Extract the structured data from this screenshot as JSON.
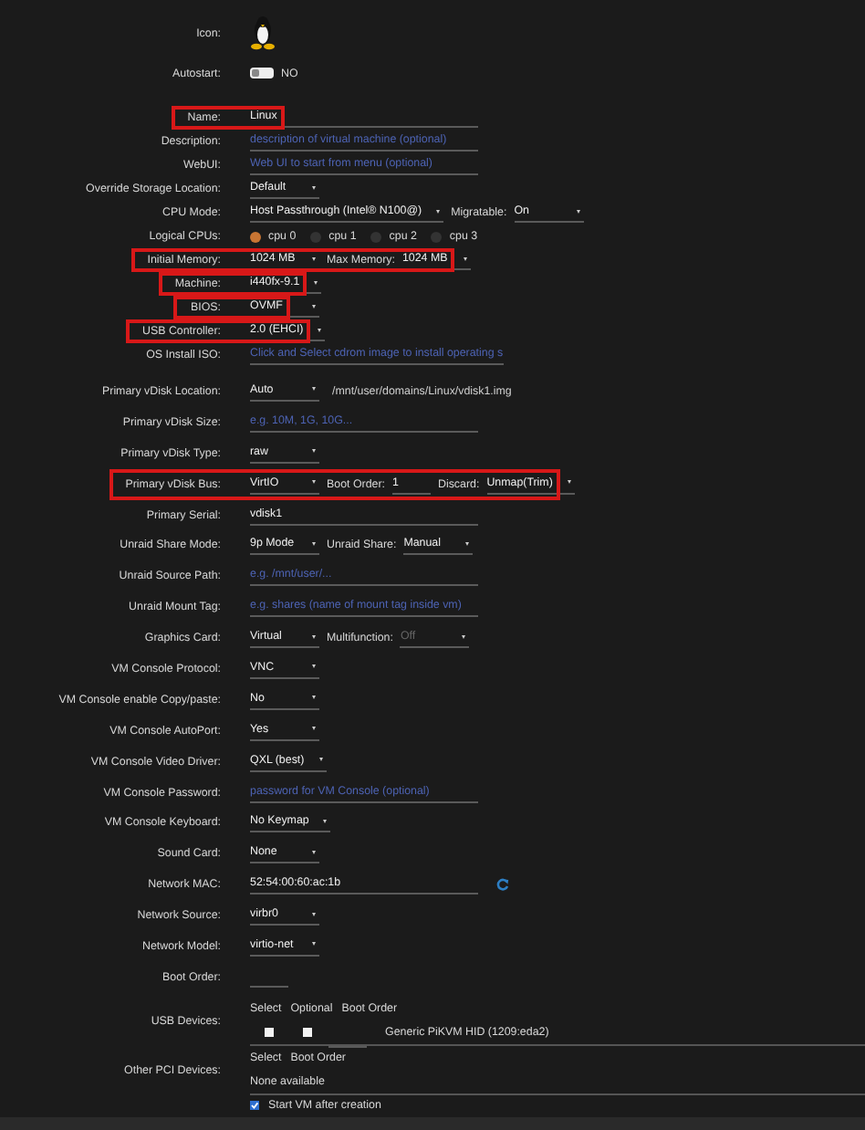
{
  "sections": [
    {
      "rows": [
        {
          "label": "Icon:",
          "highlighted": false,
          "fields": [
            {
              "kind": "icon"
            }
          ]
        },
        {
          "label": "Autostart:",
          "highlighted": false,
          "fields": [
            {
              "kind": "toggle",
              "on": false,
              "text": "NO"
            }
          ]
        }
      ]
    },
    {
      "rows": [
        {
          "label": "Name:",
          "highlighted": true,
          "fields": [
            {
              "kind": "text",
              "value": "Linux"
            }
          ]
        },
        {
          "label": "Description:",
          "highlighted": false,
          "fields": [
            {
              "kind": "placeholder",
              "placeholder": "description of virtual machine (optional)"
            }
          ]
        },
        {
          "label": "WebUI:",
          "highlighted": false,
          "fields": [
            {
              "kind": "placeholder",
              "placeholder": "Web UI to start from menu (optional)"
            }
          ]
        },
        {
          "label": "Override Storage Location:",
          "highlighted": false,
          "fields": [
            {
              "kind": "select",
              "value": "Default"
            }
          ]
        },
        {
          "label": "CPU Mode:",
          "highlighted": false,
          "fields": [
            {
              "kind": "select",
              "value": "Host Passthrough (Intel® N100@)"
            },
            {
              "kind": "caption",
              "text": "Migratable:"
            },
            {
              "kind": "select",
              "value": "On"
            }
          ]
        },
        {
          "label": "Logical CPUs:",
          "highlighted": false,
          "fields": [
            {
              "kind": "cpus",
              "items": [
                {
                  "label": "cpu 0",
                  "selected": true
                },
                {
                  "label": "cpu 1",
                  "selected": false
                },
                {
                  "label": "cpu 2",
                  "selected": false
                },
                {
                  "label": "cpu 3",
                  "selected": false
                }
              ]
            }
          ]
        },
        {
          "label": "Initial Memory:",
          "highlighted": true,
          "fields": [
            {
              "kind": "select",
              "value": "1024 MB"
            },
            {
              "kind": "caption",
              "text": "Max Memory:"
            },
            {
              "kind": "select",
              "value": "1024 MB"
            }
          ]
        },
        {
          "label": "Machine:",
          "highlighted": true,
          "fields": [
            {
              "kind": "select",
              "value": "i440fx-9.1"
            }
          ]
        },
        {
          "label": "BIOS:",
          "highlighted": true,
          "fields": [
            {
              "kind": "select",
              "value": "OVMF"
            }
          ]
        },
        {
          "label": "USB Controller:",
          "highlighted": true,
          "fields": [
            {
              "kind": "select",
              "value": "2.0 (EHCI)"
            }
          ]
        },
        {
          "label": "OS Install ISO:",
          "highlighted": false,
          "fields": [
            {
              "kind": "placeholder",
              "placeholder": "Click and Select cdrom image to install operating s"
            }
          ]
        }
      ]
    },
    {
      "rows": [
        {
          "label": "Primary vDisk Location:",
          "highlighted": false,
          "fields": [
            {
              "kind": "select",
              "value": "Auto"
            },
            {
              "kind": "path",
              "text": "/mnt/user/domains/Linux/vdisk1.img"
            }
          ]
        },
        {
          "label": "Primary vDisk Size:",
          "highlighted": false,
          "fields": [
            {
              "kind": "placeholder",
              "placeholder": "e.g. 10M, 1G, 10G..."
            }
          ]
        },
        {
          "label": "Primary vDisk Type:",
          "highlighted": false,
          "fields": [
            {
              "kind": "select",
              "value": "raw"
            }
          ]
        },
        {
          "label": "Primary vDisk Bus:",
          "highlighted": true,
          "fields": [
            {
              "kind": "select",
              "value": "VirtIO"
            },
            {
              "kind": "caption",
              "text": "Boot Order:"
            },
            {
              "kind": "number",
              "value": "1"
            },
            {
              "kind": "caption",
              "text": "Discard:"
            },
            {
              "kind": "select",
              "value": "Unmap(Trim)"
            }
          ]
        },
        {
          "label": "Primary Serial:",
          "highlighted": false,
          "fields": [
            {
              "kind": "text",
              "value": "vdisk1"
            }
          ]
        },
        {
          "label": "Unraid Share Mode:",
          "highlighted": false,
          "fields": [
            {
              "kind": "select",
              "value": "9p Mode"
            },
            {
              "kind": "caption",
              "text": "Unraid Share:"
            },
            {
              "kind": "select",
              "value": "Manual"
            }
          ]
        },
        {
          "label": "Unraid Source Path:",
          "highlighted": false,
          "fields": [
            {
              "kind": "placeholder",
              "placeholder": "e.g. /mnt/user/..."
            }
          ]
        },
        {
          "label": "Unraid Mount Tag:",
          "highlighted": false,
          "fields": [
            {
              "kind": "placeholder",
              "placeholder": "e.g. shares (name of mount tag inside vm)"
            }
          ]
        },
        {
          "label": "Graphics Card:",
          "highlighted": false,
          "fields": [
            {
              "kind": "select",
              "value": "Virtual"
            },
            {
              "kind": "caption",
              "text": "Multifunction:"
            },
            {
              "kind": "select",
              "value": "Off",
              "disabled": true
            }
          ]
        },
        {
          "label": "VM Console Protocol:",
          "highlighted": false,
          "fields": [
            {
              "kind": "select",
              "value": "VNC"
            }
          ]
        },
        {
          "label": "VM Console enable Copy/paste:",
          "highlighted": false,
          "fields": [
            {
              "kind": "select",
              "value": "No"
            }
          ]
        },
        {
          "label": "VM Console AutoPort:",
          "highlighted": false,
          "fields": [
            {
              "kind": "select",
              "value": "Yes"
            }
          ]
        },
        {
          "label": "VM Console Video Driver:",
          "highlighted": false,
          "fields": [
            {
              "kind": "select",
              "value": "QXL (best)"
            }
          ]
        },
        {
          "label": "VM Console Password:",
          "highlighted": false,
          "fields": [
            {
              "kind": "placeholder",
              "placeholder": "password for VM Console (optional)"
            }
          ]
        },
        {
          "label": "VM Console Keyboard:",
          "highlighted": false,
          "fields": [
            {
              "kind": "select",
              "value": "No Keymap"
            }
          ]
        },
        {
          "label": "Sound Card:",
          "highlighted": false,
          "fields": [
            {
              "kind": "select",
              "value": "None"
            }
          ]
        },
        {
          "label": "Network MAC:",
          "highlighted": false,
          "fields": [
            {
              "kind": "text",
              "value": "52:54:00:60:ac:1b"
            },
            {
              "kind": "refresh"
            }
          ]
        },
        {
          "label": "Network Source:",
          "highlighted": false,
          "fields": [
            {
              "kind": "select",
              "value": "virbr0"
            }
          ]
        },
        {
          "label": "Network Model:",
          "highlighted": false,
          "fields": [
            {
              "kind": "select",
              "value": "virtio-net"
            }
          ]
        },
        {
          "label": "Boot Order:",
          "highlighted": false,
          "fields": [
            {
              "kind": "number"
            }
          ]
        }
      ]
    },
    {
      "rows": [
        {
          "label": "USB Devices:",
          "highlighted": false,
          "fields": [
            {
              "kind": "devices",
              "columns": [
                "Select",
                "Optional",
                "Boot Order"
              ],
              "items": [
                {
                  "checked": false,
                  "optional": false,
                  "name": "Generic PiKVM HID (1209:eda2)"
                }
              ]
            }
          ]
        },
        {
          "label": "Other PCI Devices:",
          "highlighted": false,
          "fields": [
            {
              "kind": "devices",
              "columns": [
                "Select",
                "Boot Order"
              ],
              "empty": "None available"
            }
          ]
        },
        {
          "highlighted": false,
          "fields": [
            {
              "kind": "checkbox",
              "checked": true,
              "text": "Start VM after creation"
            }
          ]
        }
      ]
    }
  ]
}
